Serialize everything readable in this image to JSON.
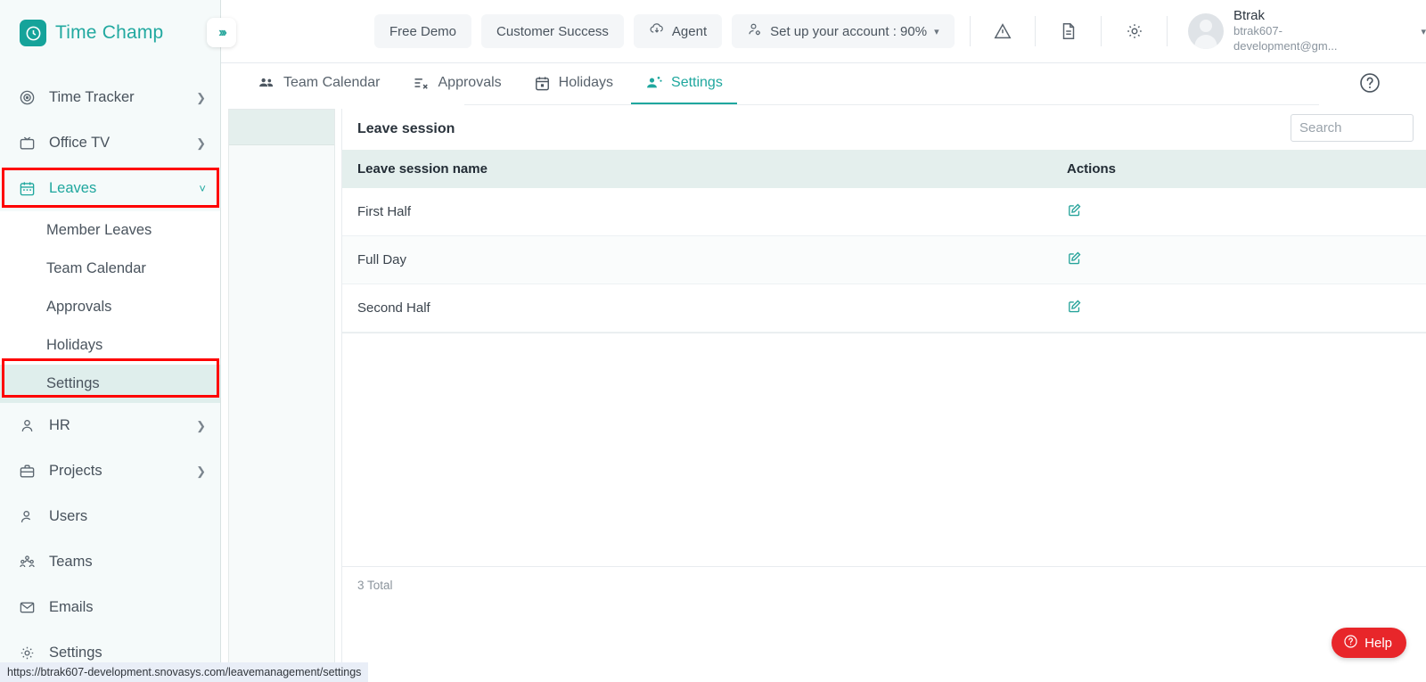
{
  "brand": {
    "name": "Time Champ",
    "logo_icon": "clock-icon"
  },
  "sidebar": {
    "collapse_icon": "chevrons-right-icon",
    "items": [
      {
        "label": "Time Tracker",
        "icon": "target-icon",
        "expandable": true,
        "active": false
      },
      {
        "label": "Office TV",
        "icon": "tv-icon",
        "expandable": true,
        "active": false
      },
      {
        "label": "Leaves",
        "icon": "calendar-icon",
        "expandable": true,
        "active": true
      }
    ],
    "sub_items": [
      {
        "label": "Member Leaves",
        "selected": false
      },
      {
        "label": "Team Calendar",
        "selected": false
      },
      {
        "label": "Approvals",
        "selected": false
      },
      {
        "label": "Holidays",
        "selected": false
      },
      {
        "label": "Settings",
        "selected": true
      }
    ],
    "items_after": [
      {
        "label": "HR",
        "icon": "person-icon",
        "expandable": true
      },
      {
        "label": "Projects",
        "icon": "briefcase-icon",
        "expandable": true
      },
      {
        "label": "Users",
        "icon": "user-icon",
        "expandable": false
      },
      {
        "label": "Teams",
        "icon": "team-icon",
        "expandable": false
      },
      {
        "label": "Emails",
        "icon": "envelope-icon",
        "expandable": false
      },
      {
        "label": "Settings",
        "icon": "gear-icon",
        "expandable": false
      }
    ]
  },
  "topbar": {
    "free_demo": "Free Demo",
    "customer_success": "Customer Success",
    "agent": "Agent",
    "agent_icon": "download-cloud-icon",
    "setup": "Set up your account : 90%",
    "setup_icon": "user-cog-icon",
    "setup_caret": "chevron-down-icon",
    "warning_icon": "warning-triangle-icon",
    "doc_icon": "document-icon",
    "gear_icon": "gear-icon",
    "profile": {
      "name": "Btrak",
      "email": "btrak607-development@gm...",
      "avatar_icon": "avatar-icon",
      "caret_icon": "chevron-down-icon"
    }
  },
  "tabs": {
    "items": [
      {
        "label": "Team Calendar",
        "icon": "people-icon",
        "active": false
      },
      {
        "label": "Approvals",
        "icon": "approvals-icon",
        "active": false
      },
      {
        "label": "Holidays",
        "icon": "calendar-date-icon",
        "active": false
      },
      {
        "label": "Settings",
        "icon": "user-settings-icon",
        "active": true
      }
    ],
    "help_icon": "question-circle-icon"
  },
  "main": {
    "card_title": "Leave session",
    "search": {
      "value": "",
      "placeholder": "Search"
    },
    "table": {
      "columns": [
        "Leave session name",
        "Actions"
      ],
      "rows": [
        {
          "name": "First Half",
          "action_icon": "edit-icon"
        },
        {
          "name": "Full Day",
          "action_icon": "edit-icon"
        },
        {
          "name": "Second Half",
          "action_icon": "edit-icon"
        }
      ]
    },
    "footer_total": "3 Total"
  },
  "help_fab": {
    "label": "Help",
    "icon": "question-circle-icon"
  },
  "status_bar": {
    "url": "https://btrak607-development.snovasys.com/leavemanagement/settings"
  },
  "colors": {
    "accent_teal": "#1fa79e",
    "sidebar_bg": "#f5fafa",
    "table_header_bg": "#e4efed",
    "annotation_red": "#fe0000",
    "help_red": "#e8262a"
  }
}
